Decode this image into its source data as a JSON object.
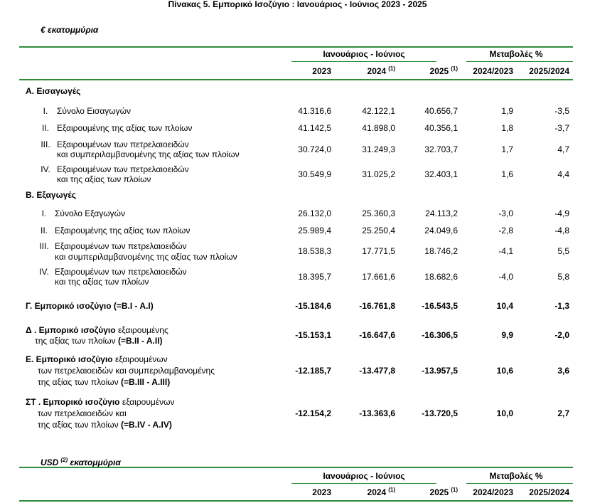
{
  "title": "Πίνακας 5. Εμπορικό Ισοζύγιο : Ιανουάριος - Ιούνιος 2023 - 2025",
  "colors": {
    "rule": "#2e8b3a",
    "text": "#000000"
  },
  "eur": {
    "unit_label": "€ εκατομμύρια",
    "header": {
      "period_group": "Ιανουάριος - Ιούνιος",
      "change_group": "Μεταβολές %",
      "year_2023": "2023",
      "year_2024": "2024",
      "year_2024_note": "(1)",
      "year_2025": "2025",
      "year_2025_note": "(1)",
      "change_2024_2023": "2024/2023",
      "change_2025_2024": "2025/2024"
    },
    "imports": {
      "heading": "Α. Εισαγωγές",
      "rows": [
        {
          "num": "I.",
          "lines": [
            "Σύνολο Εισαγωγών"
          ],
          "values": [
            "41.316,6",
            "42.122,1",
            "40.656,7",
            "1,9",
            "-3,5"
          ]
        },
        {
          "num": "II.",
          "lines": [
            "Εξαιρουμένης της αξίας των πλοίων"
          ],
          "values": [
            "41.142,5",
            "41.898,0",
            "40.356,1",
            "1,8",
            "-3,7"
          ]
        },
        {
          "num": "III.",
          "lines": [
            "Εξαιρουμένων των πετρελαιοειδών",
            "και συμπεριλαμβανομένης της αξίας των πλοίων"
          ],
          "values": [
            "30.724,0",
            "31.249,3",
            "32.703,7",
            "1,7",
            "4,7"
          ]
        },
        {
          "num": "IV.",
          "lines": [
            "Εξαιρουμένων των πετρελαιοειδών",
            "και της αξίας των πλοίων"
          ],
          "values": [
            "30.549,9",
            "31.025,2",
            "32.403,1",
            "1,6",
            "4,4"
          ]
        }
      ]
    },
    "exports": {
      "heading": "Β. Εξαγωγές",
      "rows": [
        {
          "num": "I.",
          "lines": [
            "Σύνολο Εξαγωγών"
          ],
          "values": [
            "26.132,0",
            "25.360,3",
            "24.113,2",
            "-3,0",
            "-4,9"
          ]
        },
        {
          "num": "II.",
          "lines": [
            "Εξαιρουμένης της αξίας των πλοίων"
          ],
          "values": [
            "25.989,4",
            "25.250,4",
            "24.049,6",
            "-2,8",
            "-4,8"
          ]
        },
        {
          "num": "III.",
          "lines": [
            "Εξαιρουμένων των πετρελαιοειδών",
            "και συμπεριλαμβανομένης της αξίας των πλοίων"
          ],
          "values": [
            "18.538,3",
            "17.771,5",
            "18.746,2",
            "-4,1",
            "5,5"
          ]
        },
        {
          "num": "IV.",
          "lines": [
            "Εξαιρουμένων των πετρελαιοειδών",
            "και της αξίας των πλοίων"
          ],
          "values": [
            "18.395,7",
            "17.661,6",
            "18.682,6",
            "-4,0",
            "5,8"
          ]
        }
      ]
    },
    "balance_c": {
      "label": "Γ. Εμπορικό ισοζύγιο (=Β.Ι - Α.Ι)",
      "values": [
        "-15.184,6",
        "-16.761,8",
        "-16.543,5",
        "10,4",
        "-1,3"
      ]
    },
    "balance_d": {
      "line1_bold": "Δ . Εμπορικό ισοζύγιο",
      "line1_text": "εξαιρουμένης",
      "line2_text": "της αξίας των πλοίων",
      "line2_bold": "(=Β.ΙΙ - Α.ΙΙ)",
      "values": [
        "-15.153,1",
        "-16.647,6",
        "-16.306,5",
        "9,9",
        "-2,0"
      ]
    },
    "balance_e": {
      "line1_bold": "Ε. Εμπορικό ισοζύγιο",
      "line1_text": "εξαιρουμένων",
      "line2_text": "των πετρελαιοειδών και συμπεριλαμβανομένης",
      "line3_text": "της αξίας των πλοίων",
      "line3_bold": "(=Β.ΙΙΙ - Α.ΙΙΙ)",
      "values": [
        "-12.185,7",
        "-13.477,8",
        "-13.957,5",
        "10,6",
        "3,6"
      ]
    },
    "balance_st": {
      "line1_bold": "ΣΤ . Εμπορικό ισοζύγιο",
      "line1_text": "εξαιρουμένων",
      "line2_text": "των πετρελαιοειδών και",
      "line3_text": "της αξίας των πλοίων",
      "line3_bold": "(=B.IV - A.IV)",
      "values": [
        "-12.154,2",
        "-13.363,6",
        "-13.720,5",
        "10,0",
        "2,7"
      ]
    }
  },
  "usd": {
    "unit_label": "USD",
    "unit_note": "(2)",
    "unit_suffix": "εκατομμύρια",
    "header": {
      "period_group": "Ιανουάριος - Ιούνιος",
      "change_group": "Μεταβολές %",
      "year_2023": "2023",
      "year_2024": "2024",
      "year_2024_note": "(1)",
      "year_2025": "2025",
      "year_2025_note": "(1)",
      "change_2024_2023": "2024/2023",
      "change_2025_2024": "2025/2024"
    }
  }
}
